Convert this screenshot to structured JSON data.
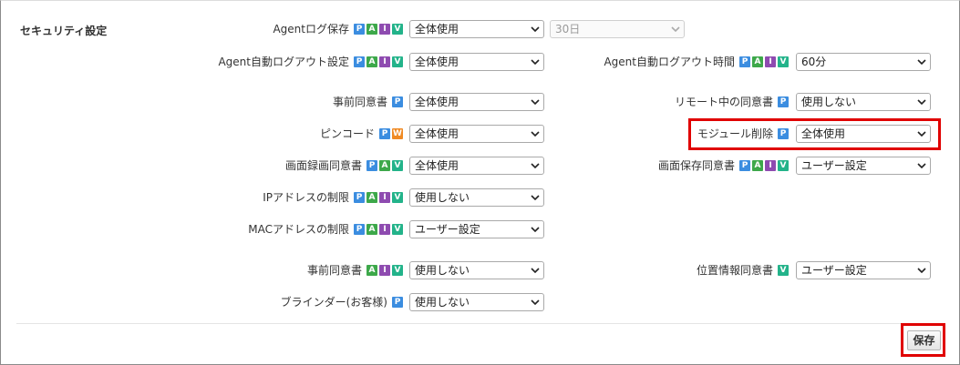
{
  "section": {
    "title": "セキュリティ設定"
  },
  "badge_colors": {
    "P": "#3b8de0",
    "A": "#3da84a",
    "I": "#8e4bb0",
    "V": "#23b38a",
    "W": "#f08a24"
  },
  "rows": {
    "agent_log": {
      "label": "Agentログ保存",
      "badges": [
        "P",
        "A",
        "I",
        "V"
      ],
      "value": "全体使用",
      "extra_value": "30日"
    },
    "agent_logout": {
      "label": "Agent自動ログアウト設定",
      "badges": [
        "P",
        "A",
        "I",
        "V"
      ],
      "value": "全体使用"
    },
    "agent_logout_time": {
      "label": "Agent自動ログアウト時間",
      "badges": [
        "P",
        "A",
        "I",
        "V"
      ],
      "value": "60分"
    },
    "prior_consent": {
      "label": "事前同意書",
      "badges": [
        "P"
      ],
      "value": "全体使用"
    },
    "remote_consent": {
      "label": "リモート中の同意書",
      "badges": [
        "P"
      ],
      "value": "使用しない"
    },
    "pin_code": {
      "label": "ピンコード",
      "badges": [
        "P",
        "W"
      ],
      "value": "全体使用"
    },
    "module_delete": {
      "label": "モジュール削除",
      "badges": [
        "P"
      ],
      "value": "全体使用"
    },
    "screen_rec_consent": {
      "label": "画面録画同意書",
      "badges": [
        "P",
        "A",
        "V"
      ],
      "value": "全体使用"
    },
    "screen_save_consent": {
      "label": "画面保存同意書",
      "badges": [
        "P",
        "A",
        "I",
        "V"
      ],
      "value": "ユーザー設定"
    },
    "ip_limit": {
      "label": "IPアドレスの制限",
      "badges": [
        "P",
        "A",
        "I",
        "V"
      ],
      "value": "使用しない"
    },
    "mac_limit": {
      "label": "MACアドレスの制限",
      "badges": [
        "P",
        "A",
        "I",
        "V"
      ],
      "value": "ユーザー設定"
    },
    "prior_consent_2": {
      "label": "事前同意書",
      "badges": [
        "A",
        "I",
        "V"
      ],
      "value": "使用しない"
    },
    "location_consent": {
      "label": "位置情報同意書",
      "badges": [
        "V"
      ],
      "value": "ユーザー設定"
    },
    "blinder": {
      "label": "ブラインダー(お客様)",
      "badges": [
        "P"
      ],
      "value": "使用しない"
    }
  },
  "actions": {
    "save_label": "保存"
  }
}
